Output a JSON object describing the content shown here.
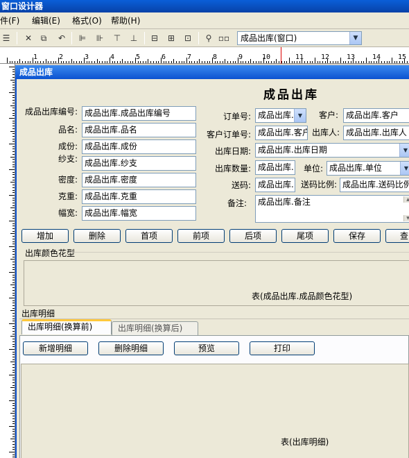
{
  "app": {
    "title": "窗口设计器"
  },
  "menu": [
    "件(F)",
    "编辑(E)",
    "格式(O)",
    "帮助(H)"
  ],
  "toolbar": {
    "icons": [
      "align-left-icon",
      "cut-icon",
      "copy-icon",
      "undo-icon",
      "align-tools-icon",
      "size-tools-icon",
      "grid-icon",
      "tab-order-icon"
    ],
    "window_selector": "成品出库(窗口)"
  },
  "ruler": {
    "numbers": [
      "1",
      "2",
      "3",
      "4",
      "5",
      "6",
      "7",
      "8",
      "9",
      "10",
      "11",
      "12",
      "13",
      "14",
      "15"
    ],
    "vnumbers": [
      "2",
      "3",
      "4",
      "5",
      "6",
      "7",
      "8",
      "9",
      "10",
      "11",
      "12",
      "13",
      "14",
      "15",
      "16",
      "17"
    ]
  },
  "window": {
    "title": "成品出库",
    "form_title": "成品出库"
  },
  "left_fields": [
    {
      "label": "成品出库编号:",
      "value": "成品出库.成品出库编号"
    },
    {
      "label": "品名:",
      "value": "成品出库.品名"
    },
    {
      "label": "成份:",
      "value": "成品出库.成份"
    },
    {
      "label": "纱支:",
      "value": "成品出库.纱支"
    },
    {
      "label": "密度:",
      "value": "成品出库.密度"
    },
    {
      "label": "克重:",
      "value": "成品出库.克重"
    },
    {
      "label": "幅宽:",
      "value": "成品出库.幅宽"
    }
  ],
  "right_fields": {
    "order_no": {
      "label": "订单号:",
      "value": "成品出库."
    },
    "customer": {
      "label": "客户:",
      "value": "成品出库.客户"
    },
    "customer_order": {
      "label": "客户订单号:",
      "value": "成品出库.客户"
    },
    "issuer": {
      "label": "出库人:",
      "value": "成品出库.出库人"
    },
    "date": {
      "label": "出库日期:",
      "value": "成品出库.出库日期"
    },
    "qty": {
      "label": "出库数量:",
      "value": "成品出库."
    },
    "unit": {
      "label": "单位:",
      "value": "成品出库.单位"
    },
    "send_code": {
      "label": "送码:",
      "value": "成品出库."
    },
    "send_ratio": {
      "label": "送码比例:",
      "value": "成品出库.送码比例"
    },
    "remark": {
      "label": "备注:",
      "value": "成品出库.备注"
    }
  },
  "buttons": [
    "增加",
    "删除",
    "首项",
    "前项",
    "后项",
    "尾项",
    "保存",
    "查"
  ],
  "color_section": {
    "caption": "出库颜色花型",
    "table_label": "表(成品出库.成品颜色花型)"
  },
  "detail_section": {
    "caption": "出库明细",
    "tabs": [
      "出库明细(换算前)",
      "出库明细(换算后)"
    ],
    "buttons": [
      "新增明细",
      "删除明细",
      "预览",
      "打印"
    ],
    "table_label": "表(出库明细)"
  }
}
